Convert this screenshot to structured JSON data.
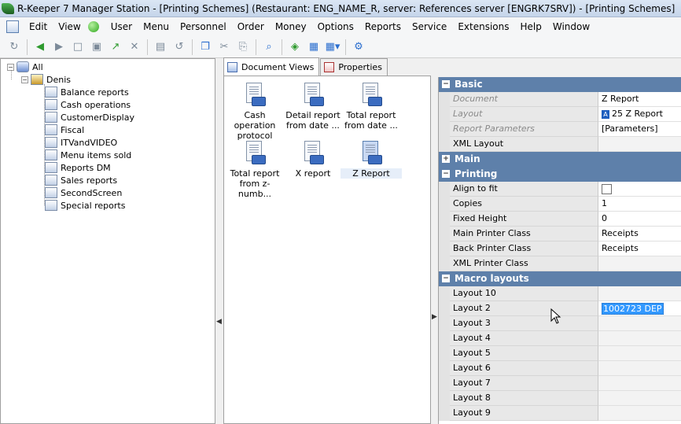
{
  "window": {
    "title": "R-Keeper 7 Manager Station - [Printing Schemes] (Restaurant: ENG_NAME_R, server: References server [ENGRK7SRV]) - [Printing Schemes]"
  },
  "menu": [
    {
      "id": "edit",
      "label": "Edit"
    },
    {
      "id": "view",
      "label": "View"
    },
    {
      "id": "user",
      "label": "User"
    },
    {
      "id": "menu",
      "label": "Menu"
    },
    {
      "id": "personnel",
      "label": "Personnel"
    },
    {
      "id": "order",
      "label": "Order"
    },
    {
      "id": "money",
      "label": "Money"
    },
    {
      "id": "options",
      "label": "Options"
    },
    {
      "id": "reports",
      "label": "Reports"
    },
    {
      "id": "service",
      "label": "Service"
    },
    {
      "id": "extensions",
      "label": "Extensions"
    },
    {
      "id": "help",
      "label": "Help"
    },
    {
      "id": "window",
      "label": "Window"
    }
  ],
  "toolbar": {
    "buttons": [
      "refresh-icon",
      "back-icon",
      "forward-icon",
      "new-icon",
      "save-icon",
      "export-icon",
      "delete-icon",
      "save-all-icon",
      "undo-icon",
      "copy-icon",
      "cut-icon",
      "paste-icon",
      "find-icon",
      "filter-icon",
      "layers-icon",
      "grid-view-icon",
      "settings-icon"
    ]
  },
  "tree": {
    "root": "All",
    "user": "Denis",
    "items": [
      "Balance reports",
      "Cash operations",
      "CustomerDisplay",
      "Fiscal",
      "ITVandVIDEO",
      "Menu items sold",
      "Reports DM",
      "Sales reports",
      "SecondScreen",
      "Special reports"
    ]
  },
  "tabs": {
    "document_views": "Document Views",
    "properties": "Properties"
  },
  "documents": [
    {
      "line1": "Cash operation",
      "line2": "protocol"
    },
    {
      "line1": "Detail report",
      "line2": "from date ..."
    },
    {
      "line1": "Total report",
      "line2": "from date ..."
    },
    {
      "line1": "Total report",
      "line2": "from z-numb..."
    },
    {
      "line1": "X report",
      "line2": ""
    },
    {
      "line1": "Z Report",
      "line2": ""
    }
  ],
  "properties": {
    "sections": {
      "basic": "Basic",
      "main": "Main",
      "printing": "Printing",
      "macro": "Macro layouts"
    },
    "basic": [
      {
        "name": "Document",
        "value": "Z Report",
        "disabled": true
      },
      {
        "name": "Layout",
        "value": "25 Z Report",
        "badge": "A",
        "disabled": true
      },
      {
        "name": "Report Parameters",
        "value": "[Parameters]",
        "disabled": true
      },
      {
        "name": "XML Layout",
        "value": ""
      }
    ],
    "printing": [
      {
        "name": "Align to fit",
        "value": ""
      },
      {
        "name": "Copies",
        "value": "1"
      },
      {
        "name": "Fixed Height",
        "value": "0"
      },
      {
        "name": "Main Printer Class",
        "value": "Receipts"
      },
      {
        "name": "Back Printer Class",
        "value": "Receipts"
      },
      {
        "name": "XML Printer Class",
        "value": ""
      }
    ],
    "macro": [
      {
        "name": "Layout 10",
        "value": ""
      },
      {
        "name": "Layout 2",
        "value": "1002723 DEP"
      },
      {
        "name": "Layout 3",
        "value": ""
      },
      {
        "name": "Layout 4",
        "value": ""
      },
      {
        "name": "Layout 5",
        "value": ""
      },
      {
        "name": "Layout 6",
        "value": ""
      },
      {
        "name": "Layout 7",
        "value": ""
      },
      {
        "name": "Layout 8",
        "value": ""
      },
      {
        "name": "Layout 9",
        "value": ""
      }
    ]
  }
}
